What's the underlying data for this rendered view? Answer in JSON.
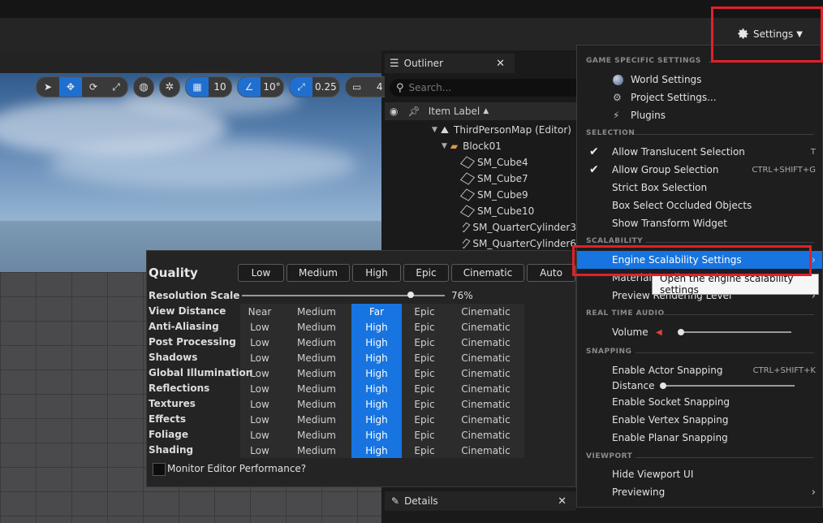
{
  "toolbar": {
    "settings_label": "Settings"
  },
  "viewport": {
    "grid_snap": "10",
    "angle_snap": "10°",
    "scale_snap": "0.25",
    "camera_speed": "4"
  },
  "outliner": {
    "tab_label": "Outliner",
    "search_placeholder": "Search...",
    "column_label": "Item Label",
    "items": [
      {
        "label": "ThirdPersonMap (Editor)"
      },
      {
        "label": "Block01"
      },
      {
        "label": "SM_Cube4"
      },
      {
        "label": "SM_Cube7"
      },
      {
        "label": "SM_Cube9"
      },
      {
        "label": "SM_Cube10"
      },
      {
        "label": "SM_QuarterCylinder3"
      },
      {
        "label": "SM_QuarterCylinder6"
      }
    ]
  },
  "details": {
    "tab_label": "Details"
  },
  "scalability": {
    "title": "Quality",
    "presets": [
      "Low",
      "Medium",
      "High",
      "Epic",
      "Cinematic",
      "Auto"
    ],
    "resolution_label": "Resolution Scale",
    "resolution_value": "76%",
    "resolution_fraction": 0.76,
    "rows": [
      {
        "label": "View Distance",
        "levels": [
          "Near",
          "Medium",
          "Far",
          "Epic",
          "Cinematic"
        ],
        "selected": 2
      },
      {
        "label": "Anti-Aliasing",
        "levels": [
          "Low",
          "Medium",
          "High",
          "Epic",
          "Cinematic"
        ],
        "selected": 2
      },
      {
        "label": "Post Processing",
        "levels": [
          "Low",
          "Medium",
          "High",
          "Epic",
          "Cinematic"
        ],
        "selected": 2
      },
      {
        "label": "Shadows",
        "levels": [
          "Low",
          "Medium",
          "High",
          "Epic",
          "Cinematic"
        ],
        "selected": 2
      },
      {
        "label": "Global Illumination",
        "levels": [
          "Low",
          "Medium",
          "High",
          "Epic",
          "Cinematic"
        ],
        "selected": 2
      },
      {
        "label": "Reflections",
        "levels": [
          "Low",
          "Medium",
          "High",
          "Epic",
          "Cinematic"
        ],
        "selected": 2
      },
      {
        "label": "Textures",
        "levels": [
          "Low",
          "Medium",
          "High",
          "Epic",
          "Cinematic"
        ],
        "selected": 2
      },
      {
        "label": "Effects",
        "levels": [
          "Low",
          "Medium",
          "High",
          "Epic",
          "Cinematic"
        ],
        "selected": 2
      },
      {
        "label": "Foliage",
        "levels": [
          "Low",
          "Medium",
          "High",
          "Epic",
          "Cinematic"
        ],
        "selected": 2
      },
      {
        "label": "Shading",
        "levels": [
          "Low",
          "Medium",
          "High",
          "Epic",
          "Cinematic"
        ],
        "selected": 2
      }
    ],
    "monitor_label": "Monitor Editor Performance?"
  },
  "menu": {
    "sections": {
      "game": "GAME SPECIFIC SETTINGS",
      "selection": "SELECTION",
      "scalability": "SCALABILITY",
      "audio": "REAL TIME AUDIO",
      "snapping": "SNAPPING",
      "viewport": "VIEWPORT"
    },
    "world_settings": "World Settings",
    "project_settings": "Project Settings...",
    "plugins": "Plugins",
    "allow_translucent": "Allow Translucent Selection",
    "allow_translucent_sc": "T",
    "allow_group": "Allow Group Selection",
    "allow_group_sc": "CTRL+SHIFT+G",
    "strict_box": "Strict Box Selection",
    "box_occluded": "Box Select Occluded Objects",
    "show_transform": "Show Transform Widget",
    "engine_scalability": "Engine Scalability Settings",
    "material_quality": "Material Quality Level",
    "preview_rendering": "Preview Rendering Level",
    "volume": "Volume",
    "enable_actor_snapping": "Enable Actor Snapping",
    "enable_actor_snapping_sc": "CTRL+SHIFT+K",
    "distance": "Distance",
    "enable_socket": "Enable Socket Snapping",
    "enable_vertex": "Enable Vertex Snapping",
    "enable_planar": "Enable Planar Snapping",
    "hide_viewport_ui": "Hide Viewport UI",
    "previewing": "Previewing"
  },
  "tooltip": "Open the engine scalability settings",
  "colors": {
    "accent": "#1774e0",
    "highlight_box": "#e2202a"
  }
}
